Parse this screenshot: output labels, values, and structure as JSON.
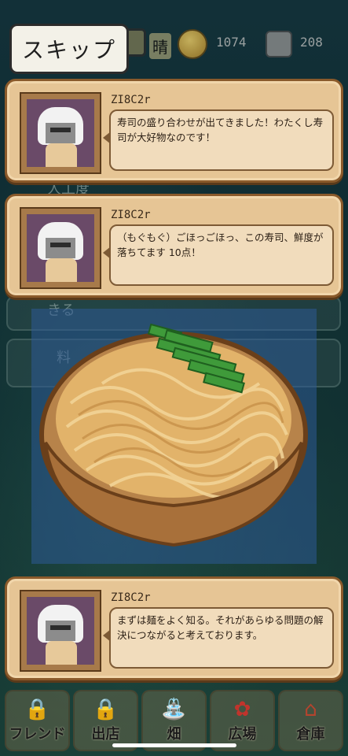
{
  "top_bar": {
    "weather": "晴",
    "coins": "1074",
    "gems": "208",
    "coin_icon": "coin-icon",
    "gem_icon": "gem-icon"
  },
  "skip_label": "スキップ",
  "dialogs": [
    {
      "speaker": "ZI8C2r",
      "text": "寿司の盛り合わせが出てきました！わたくし寿司が大好物なのです！"
    },
    {
      "speaker": "ZI8C2r",
      "text": "（もぐもぐ）ごほっごほっ、この寿司、鮮度が落ちてます 10点！"
    },
    {
      "speaker": "ZI8C2r",
      "text": "まずは麺をよく知る。それがあらゆる問題の解決につながると考えております。"
    }
  ],
  "background_menu": {
    "label_a": "人工度",
    "label_b": "きる",
    "label_c": "料"
  },
  "bottom_nav": [
    {
      "label": "フレンド",
      "icon": "lock-icon"
    },
    {
      "label": "出店",
      "icon": "lock-icon"
    },
    {
      "label": "畑",
      "icon": "watering-can-icon"
    },
    {
      "label": "広場",
      "icon": "flower-icon"
    },
    {
      "label": "倉庫",
      "icon": "house-icon"
    }
  ],
  "colors": {
    "card": "#e6c595",
    "card_border": "#8a5a2b",
    "bowl_bg": "#2e5a96"
  }
}
